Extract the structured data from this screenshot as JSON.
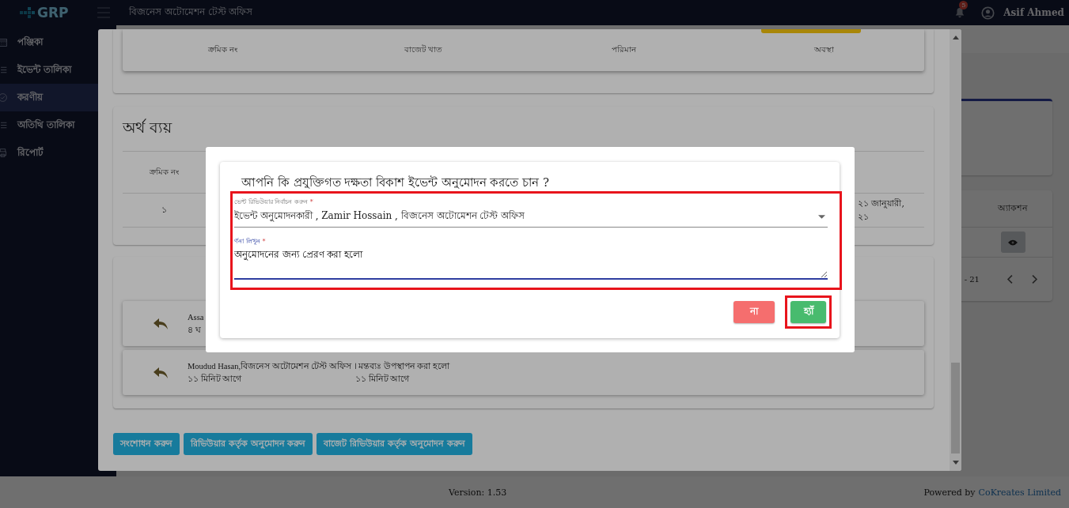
{
  "topbar": {
    "logo": "GRP",
    "office": "বিজনেস অটোমেশন টেস্ট অফিস",
    "notification_count": "5",
    "user": "Asif Ahmed"
  },
  "sidebar": {
    "items": [
      {
        "label": "পঞ্জিকা",
        "kind": "calendar",
        "selected": false
      },
      {
        "label": "ইভেন্ট তালিকা",
        "kind": "list",
        "selected": false
      },
      {
        "label": "করণীয়",
        "kind": "check",
        "selected": true
      },
      {
        "label": "অতিথি তালিকা",
        "kind": "list",
        "selected": false
      },
      {
        "label": "রিপোর্ট",
        "kind": "report",
        "selected": false
      }
    ]
  },
  "page": {
    "table": {
      "columns": [
        "অ্যাকশন"
      ],
      "pagination": "- 21"
    }
  },
  "modal": {
    "budget_table": {
      "columns": [
        "ক্রমিক নং",
        "বাজেট খাত",
        "পরিমান",
        "অবস্থা"
      ]
    },
    "expense": {
      "title": "অর্থ ব্যয়",
      "columns": [
        "ক্রমিক নং"
      ],
      "rows": [
        {
          "serial": "১",
          "date": "২১ জানুয়ারী, ২১"
        }
      ]
    },
    "history": [
      {
        "text": "Assa",
        "time": "৪ ঘ"
      },
      {
        "text": "Moudud Hasan,বিজনেস অটোমেশন টেস্ট অফিস । মন্তব্যঃ উপস্থাপন করা হলো",
        "time": "১১ মিনিট আগে",
        "time_2": "১১ মিনিট আগে"
      }
    ],
    "actions": [
      "সংশোধন করুন",
      "রিভিউয়ার কর্তৃক অনুমোদন করুন",
      "বাজেট রিভিউয়ার কর্তৃক অনুমোদন করুন"
    ]
  },
  "dialog": {
    "question": "আপনি কি প্রযুক্তিগত দক্ষতা বিকাশ ইভেন্ট অনুমোদন করতে চান ?",
    "form": {
      "highlighted": true,
      "reviewer_field": {
        "label": "ভেন্ট রিভিউয়ার নির্বাচন করুন",
        "required_mark": "*",
        "value": "ইভেন্ট অনুমোদনকারী , Zamir Hossain , বিজনেস অটোমেশন টেস্ট অফিস"
      },
      "description_field": {
        "label": "র্ণনা লিখুন",
        "required_mark": "*",
        "value": "অনুমোদনের জন্য প্রেরণ করা হলো"
      }
    },
    "buttons": [
      {
        "label": "না",
        "kind": "cancel",
        "highlighted": false
      },
      {
        "label": "হ্যাঁ",
        "kind": "confirm",
        "highlighted": true
      }
    ]
  },
  "footer": {
    "version": "Version: 1.53",
    "powered_by": "Powered by",
    "company": "CoKreates Limited"
  }
}
